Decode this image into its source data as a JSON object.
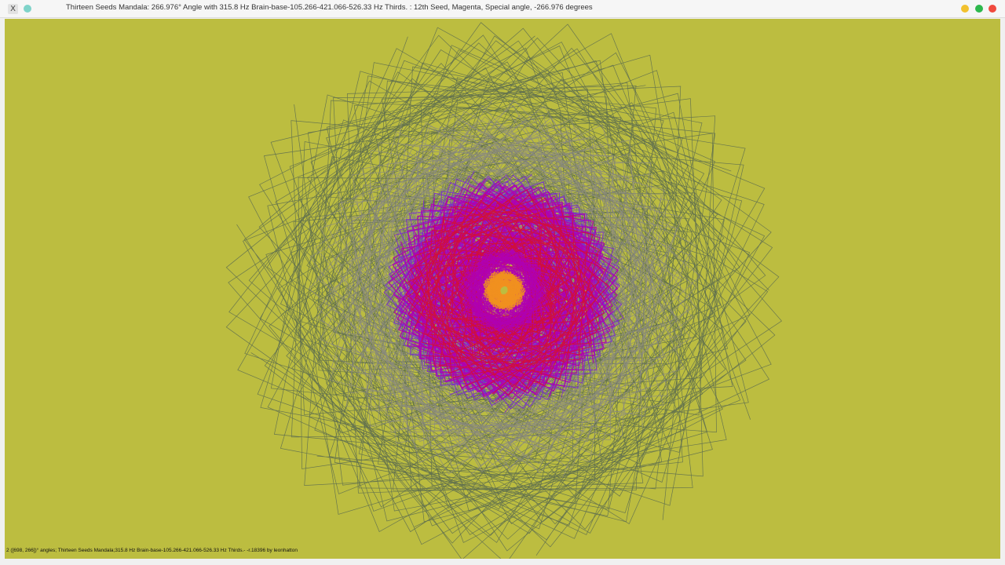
{
  "window": {
    "title": "Thirteen Seeds Mandala: 266.976° Angle with 315.8 Hz Brain-base-105.266-421.066-526.33 Hz Thirds. : 12th Seed, Magenta, Special angle, -266.976 degrees",
    "app_icon": "x-app-icon",
    "buttons": [
      "minimize-button",
      "maximize-button",
      "close-button"
    ]
  },
  "canvas": {
    "background": "#bcbd40",
    "caption": "2 ([698, 266])° angles; Thirteen Seeds Mandala;315.8 Hz Brain-base-105.266-421.066-526.33 Hz Thirds.- -r.18396 by leonhatton"
  },
  "mandala": {
    "angle_degrees": 266.976,
    "outer_color": "#5f6f4f",
    "grey_color": "#8a8a7e",
    "magenta_color": "#b000b0",
    "red_color": "#d0103a",
    "purple_color": "#7a2ad0",
    "orange_color": "#f09020"
  }
}
